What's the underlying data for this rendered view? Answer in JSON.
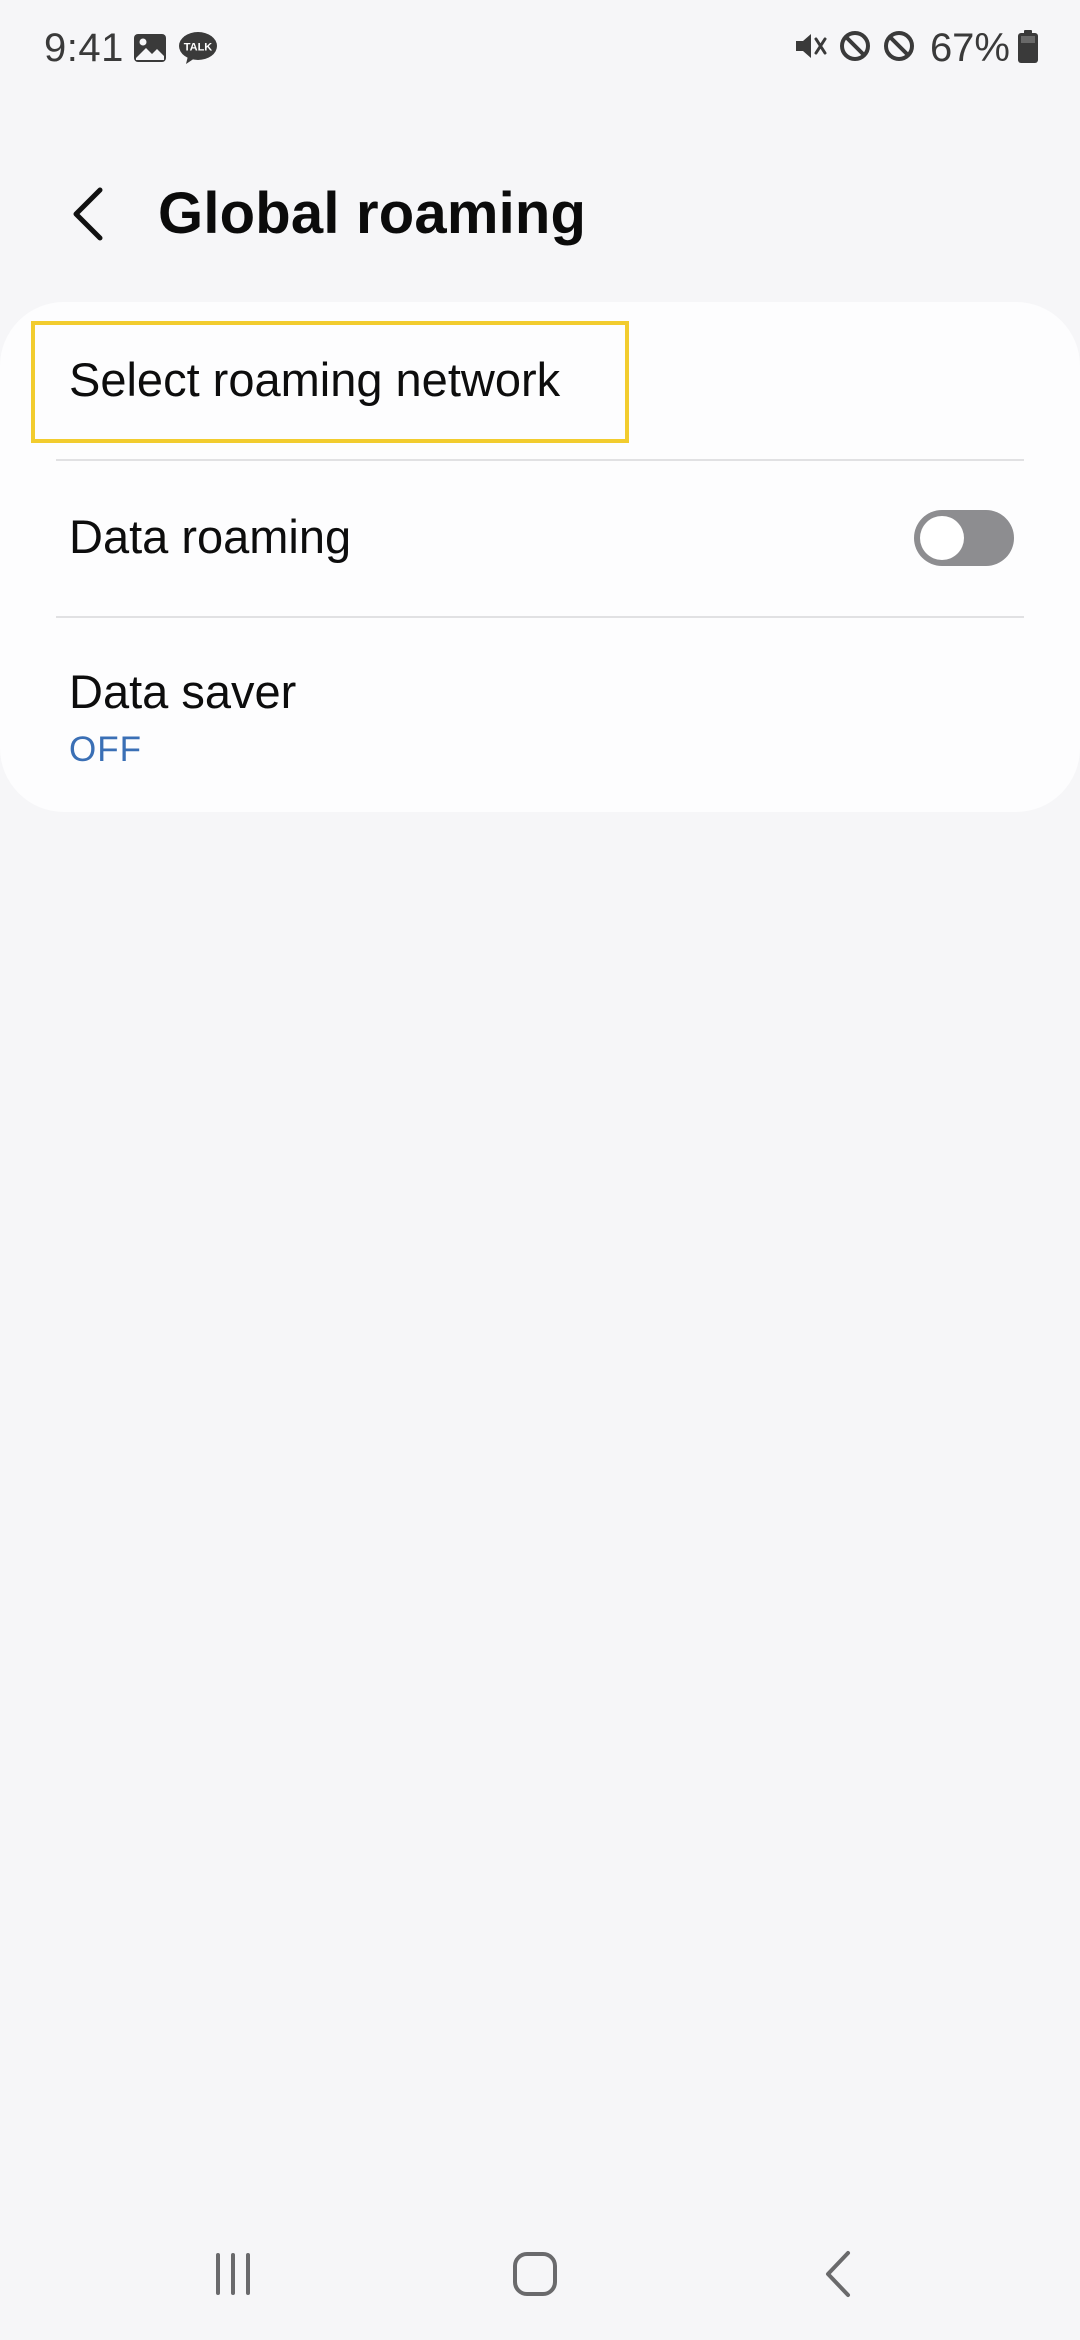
{
  "status_bar": {
    "time": "9:41",
    "battery_percent": "67%",
    "left_icons": [
      "gallery-icon",
      "talk-icon"
    ],
    "talk_badge": "TALK",
    "right_icons": [
      "vibrate-mute-icon",
      "block-icon",
      "block-icon",
      "battery-icon"
    ]
  },
  "header": {
    "title": "Global roaming",
    "back_icon": "chevron-left-icon"
  },
  "settings": {
    "items": [
      {
        "label": "Select roaming network"
      },
      {
        "label": "Data roaming",
        "toggle_on": false
      },
      {
        "label": "Data saver",
        "sublabel": "OFF"
      }
    ]
  },
  "nav_bar": {
    "buttons": [
      "recents-icon",
      "home-icon",
      "back-icon"
    ]
  },
  "colors": {
    "background": "#f6f6f8",
    "card": "#fdfdfe",
    "highlight": "#f2cc2e",
    "accent_sublabel": "#3a6fb5",
    "toggle_off": "#8d8d90"
  }
}
